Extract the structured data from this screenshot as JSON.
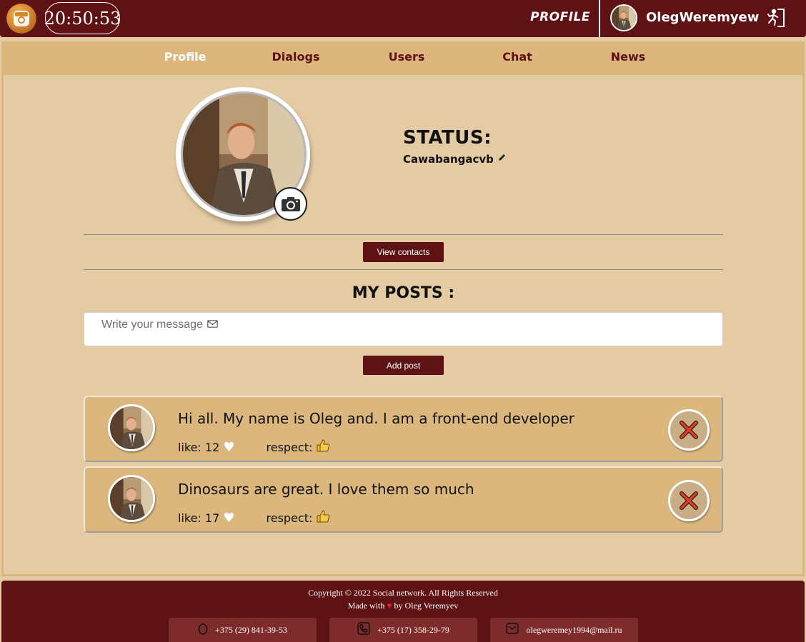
{
  "header": {
    "logo_icon": "instagram-icon",
    "clock": "20:50:53",
    "title": "PROFILE",
    "user_name": "OlegWeremyew",
    "exit_icon": "logout-icon"
  },
  "nav": {
    "items": [
      {
        "label": "Profile",
        "active": true
      },
      {
        "label": "Dialogs",
        "active": false
      },
      {
        "label": "Users",
        "active": false
      },
      {
        "label": "Chat",
        "active": false
      },
      {
        "label": "News",
        "active": false
      }
    ]
  },
  "profile": {
    "status_title": "STATUS:",
    "status_text": "Cawabangacvb",
    "view_contacts_label": "View contacts"
  },
  "posts_section": {
    "title": "MY POSTS :",
    "input_placeholder": "Write your message",
    "add_post_label": "Add post",
    "like_label": "like:",
    "respect_label": "respect:",
    "items": [
      {
        "text": "Hi all. My name is Oleg and. I am a front-end developer",
        "likes": "12"
      },
      {
        "text": "Dinosaurs are great. I love them so much",
        "likes": "17"
      }
    ]
  },
  "footer": {
    "copyright": "Copyright © 2022 Social network. All Rights Reserved",
    "made_with_prefix": "Made with",
    "made_with_suffix": "by Oleg Veremyev",
    "contacts": [
      {
        "icon": "egg-icon",
        "text": "+375 (29) 841-39-53"
      },
      {
        "icon": "phone-icon",
        "text": "+375 (17) 358-29-79"
      },
      {
        "icon": "mail-icon",
        "text": "olegweremey1994@mail.ru"
      }
    ]
  },
  "colors": {
    "primary": "#5f1214",
    "nav_bg": "#dbb77e",
    "page_bg": "#e4cba4",
    "footer_contact_bg": "#7e2b2c"
  }
}
